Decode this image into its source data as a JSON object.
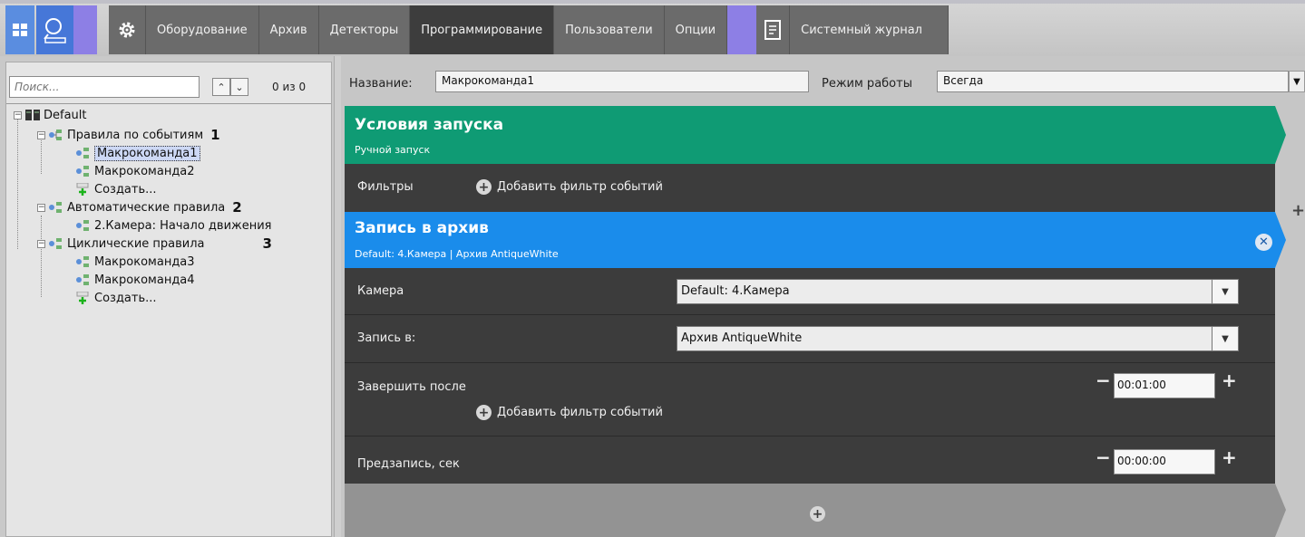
{
  "toolbar": {
    "tabs": [
      {
        "label": "Оборудование"
      },
      {
        "label": "Архив"
      },
      {
        "label": "Детекторы"
      },
      {
        "label": "Программирование"
      },
      {
        "label": "Пользователи"
      },
      {
        "label": "Опции"
      },
      {
        "label": "Системный журнал"
      }
    ],
    "active_tab": "Программирование"
  },
  "tree": {
    "search_placeholder": "Поиск...",
    "counter": "0 из 0",
    "root": "Default",
    "groups": [
      {
        "label": "Правила по событиям",
        "num": "1",
        "items": [
          "Макрокоманда1",
          "Макрокоманда2",
          "Создать..."
        ]
      },
      {
        "label": "Автоматические правила",
        "num": "2",
        "items": [
          "2.Камера: Начало движения"
        ]
      },
      {
        "label": "Циклические правила",
        "num": "3",
        "items": [
          "Макрокоманда3",
          "Макрокоманда4",
          "Создать..."
        ]
      }
    ]
  },
  "form": {
    "name_label": "Название:",
    "name_value": "Макрокоманда1",
    "mode_label": "Режим работы",
    "mode_value": "Всегда"
  },
  "conditions": {
    "title": "Условия запуска",
    "subtitle": "Ручной запуск",
    "filters_label": "Фильтры",
    "add_filter": "Добавить фильтр событий"
  },
  "action": {
    "title": "Запись в архив",
    "subtitle": "Default: 4.Камера | Архив AntiqueWhite",
    "camera_label": "Камера",
    "camera_value": "Default: 4.Камера",
    "record_label": "Запись в:",
    "record_value": "Архив AntiqueWhite",
    "finish_label": "Завершить после",
    "finish_value": "00:01:00",
    "add_filter": "Добавить фильтр событий",
    "prerecord_label": "Предзапись, сек",
    "prerecord_value": "00:00:00"
  },
  "colors": {
    "conditions": "#0f9b74",
    "action": "#1a8ceb",
    "active_tab": "#3d3d3d"
  }
}
